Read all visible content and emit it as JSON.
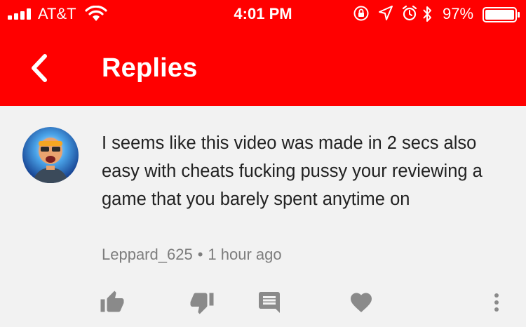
{
  "status_bar": {
    "carrier": "AT&T",
    "time": "4:01 PM",
    "battery_percent": "97%",
    "icons": [
      "signal-icon",
      "wifi-icon",
      "orientation-lock-icon",
      "location-icon",
      "alarm-icon",
      "bluetooth-icon",
      "battery-icon"
    ]
  },
  "header": {
    "title": "Replies",
    "back_icon": "chevron-left-icon",
    "color": "#ff0000"
  },
  "comment": {
    "text": "I seems like this video was made in 2 secs also easy with cheats fucking pussy your reviewing a game that you barely spent anytime on",
    "author": "Leppard_625",
    "separator": "•",
    "timestamp": "1 hour ago",
    "actions": [
      "thumbs-up-icon",
      "thumbs-down-icon",
      "reply-icon",
      "heart-icon",
      "more-vertical-icon"
    ]
  }
}
